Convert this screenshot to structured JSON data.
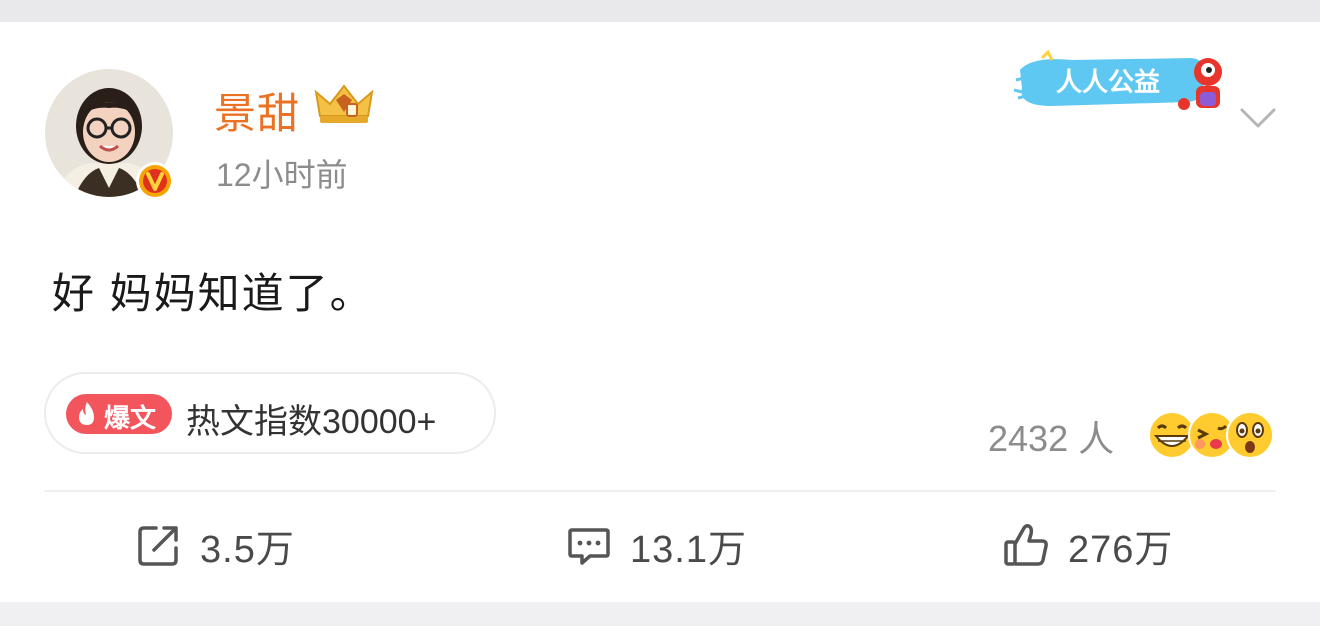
{
  "post": {
    "author": "景甜",
    "time": "12小时前",
    "content": "好 妈妈知道了。",
    "badge_text": "人人公益",
    "hot": {
      "tag": "爆文",
      "index_text": "热文指数30000+"
    },
    "reactions": {
      "count_text": "2432 人"
    },
    "actions": {
      "share": "3.5万",
      "comment": "13.1万",
      "like": "276万"
    }
  },
  "icons": {
    "verified": "verified-v-icon",
    "crown": "crown-icon",
    "more": "chevron-down-icon",
    "share": "share-icon",
    "comment": "comment-icon",
    "like": "thumbs-up-icon"
  },
  "colors": {
    "author": "#eb7225",
    "hot_tag": "#f3555c",
    "muted": "#8c8c8c",
    "verified": "#f6a400"
  }
}
